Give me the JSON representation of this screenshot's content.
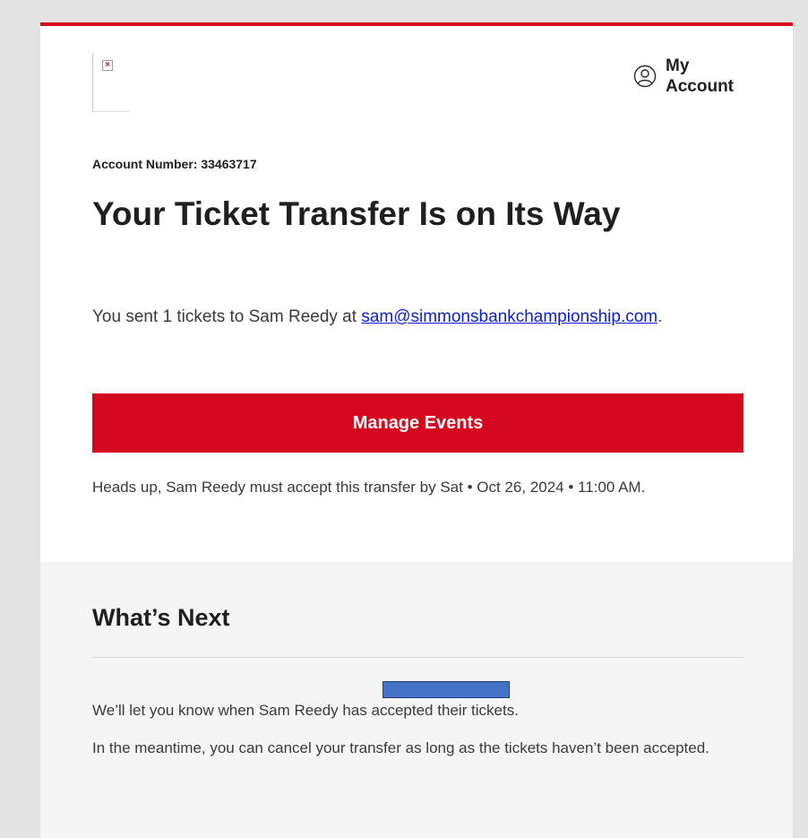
{
  "header": {
    "my_account_label": "My Account"
  },
  "account": {
    "label_text": "Account Number: 33463717"
  },
  "hero": {
    "title": "Your Ticket Transfer Is on Its Way",
    "sent_prefix": "You sent 1 tickets to Sam Reedy at ",
    "email": "sam@simmonsbankchampionship.com",
    "sent_suffix": "."
  },
  "actions": {
    "manage_events_label": "Manage Events"
  },
  "deadline": {
    "text": "Heads up, Sam Reedy must accept this transfer by Sat • Oct 26, 2024 • 11:00 AM."
  },
  "whats_next": {
    "heading": "What’s Next",
    "paragraph_1": "We’ll let you know when Sam Reedy has accepted their tickets.",
    "paragraph_2": "In the meantime, you can cancel your transfer as long as the tickets haven’t been accepted."
  },
  "colors": {
    "brand_red": "#d5081f",
    "link_blue": "#0b20d8",
    "redaction_blue": "#4472c4"
  },
  "icons": {
    "logo": "broken-image-icon",
    "account": "user-circle-icon"
  }
}
